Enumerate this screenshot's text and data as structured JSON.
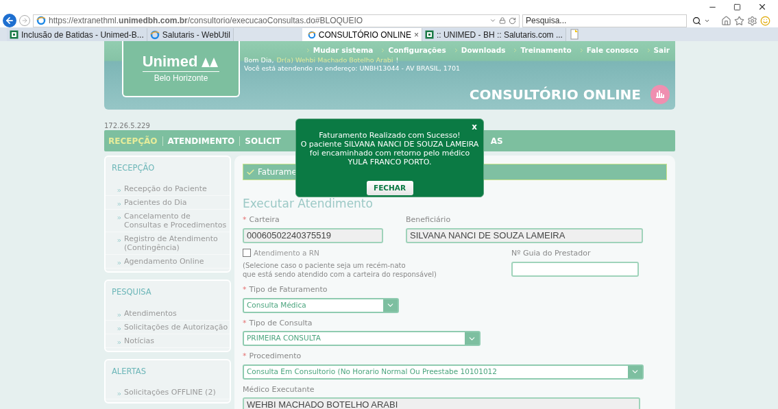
{
  "browser": {
    "url": "https://extranethml.**unimedbh.com.br**/consultorio/execucaoConsultas.do#BLOQUEIO",
    "search": {
      "placeholder": "Pesquisa..."
    },
    "tabs": [
      {
        "label": "Inclusão de Batidas - Unimed-B...",
        "selected": false,
        "kind": "site"
      },
      {
        "label": "Salutaris - WebUtil",
        "selected": false,
        "kind": "ie"
      },
      {
        "label": "CONSULTÓRIO ONLINE",
        "selected": true,
        "kind": "ie",
        "close": "×"
      },
      {
        "label": ":: UNIMED - BH :: Salutaris.com ...",
        "selected": false,
        "kind": "site"
      }
    ]
  },
  "header": {
    "logo": {
      "name": "Unimed",
      "city": "Belo Horizonte"
    },
    "links": [
      "Mudar sistema",
      "Configurações",
      "Downloads",
      "Treinamento",
      "Fale conosco",
      "Sair"
    ],
    "greeting": "Bom Dia,",
    "user": "Dr(a) Wehbi Machado Botelho Arabi",
    "greeting_end": "!",
    "address": "Você está atendendo no endereço: UNBH13044 - AV BRASIL, 1701",
    "title": "CONSULTÓRIO ONLINE"
  },
  "ip": "172.26.5.229",
  "nav": [
    {
      "label": "RECEPÇÃO",
      "selected": true
    },
    {
      "label": "ATENDIMENTO",
      "selected": false
    },
    {
      "label": "SOLICIT",
      "selected": false
    },
    {
      "label": "AS",
      "selected": false
    }
  ],
  "sidebar": [
    {
      "title": "RECEPÇÃO",
      "items": [
        "Recepção do Paciente",
        "Pacientes do Dia",
        "Cancelamento de Consultas e Procedimentos",
        "Registro de Atendimento (Contingência)",
        "Agendamento Online"
      ]
    },
    {
      "title": "PESQUISA",
      "items": [
        "Atendimentos",
        "Solicitações de Autorização",
        "Notícias"
      ]
    },
    {
      "title": "ALERTAS",
      "items": [
        "Solicitações OFFLINE (2)"
      ]
    }
  ],
  "success_bar": "Faturame",
  "heading": "Executar Atendimento",
  "form": {
    "carteira": {
      "mark": "*",
      "label": "Carteira",
      "value": "00060502240375519"
    },
    "beneficiario": {
      "label": "Beneficiário",
      "value": "SILVANA NANCI DE SOUZA LAMEIRA"
    },
    "rn": {
      "label": "Atendimento a RN",
      "checked": false,
      "hint": "(Selecione caso o paciente seja um recém-nato\nque está sendo atendido com a carteira do responsável)"
    },
    "guia": {
      "label": "Nº Guia do Prestador"
    },
    "tipo_faturamento": {
      "mark": "*",
      "label": "Tipo de Faturamento",
      "value": "Consulta Médica"
    },
    "tipo_consulta": {
      "mark": "*",
      "label": "Tipo de Consulta",
      "value": "PRIMEIRA CONSULTA"
    },
    "procedimento": {
      "mark": "*",
      "label": "Procedimento",
      "value": "Consulta Em Consultorio (No Horario Normal Ou Preestabe 10101012"
    },
    "medico": {
      "label": "Médico Executante",
      "value": "WEHBI MACHADO BOTELHO ARABI"
    }
  },
  "modal": {
    "close": "x",
    "title": "Faturamento Realizado com Sucesso!",
    "message": "O paciente SILVANA NANCI DE SOUZA LAMEIRA foi encaminhado com retorno pelo médico YULA FRANCO PORTO.",
    "button": "FECHAR"
  }
}
